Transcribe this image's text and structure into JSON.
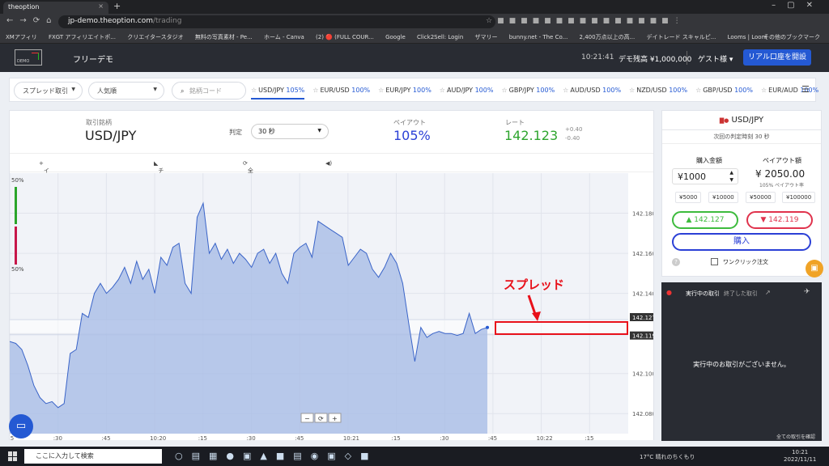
{
  "browser": {
    "tab_title": "theoption",
    "url_host": "jp-demo.theoption.com",
    "url_path": "/trading",
    "bookmarks": [
      "XMアフィリ",
      "FXGT アフィリエイトポ...",
      "クリエイタースタジオ",
      "無料の写真素材 - Pe...",
      "ホーム - Canva",
      "(2) 🔴 (FULL COUR...",
      "Google",
      "Click2Sell: Login",
      "ザマリー",
      "bunny.net - The Co...",
      "2,400万点以上の高...",
      "デイトレード スキャルピ...",
      "Looms | Loom"
    ],
    "bookmarks_other": "その他のブックマーク"
  },
  "header": {
    "logo_text": "DEMO",
    "mode_label": "フリーデモ",
    "time": "10:21:41",
    "balance": "デモ残高 ¥1,000,000",
    "user": "ゲスト様 ▾",
    "real_account_button": "リアル口座を開設"
  },
  "filters": {
    "type_select": "スプレッド取引",
    "sort_select": "人気順",
    "search_placeholder": "銘柄コード",
    "pairs": [
      {
        "name": "USD/JPY",
        "pct": "105%",
        "active": true
      },
      {
        "name": "EUR/USD",
        "pct": "100%",
        "active": false
      },
      {
        "name": "EUR/JPY",
        "pct": "100%",
        "active": false
      },
      {
        "name": "AUD/JPY",
        "pct": "100%",
        "active": false
      },
      {
        "name": "GBP/JPY",
        "pct": "100%",
        "active": false
      },
      {
        "name": "AUD/USD",
        "pct": "100%",
        "active": false
      },
      {
        "name": "NZD/USD",
        "pct": "100%",
        "active": false
      },
      {
        "name": "GBP/USD",
        "pct": "100%",
        "active": false
      },
      {
        "name": "EUR/AUD",
        "pct": "100%",
        "active": false
      }
    ]
  },
  "info": {
    "symbol_label": "取引銘柄",
    "symbol": "USD/JPY",
    "judge_label": "判定",
    "duration": "30 秒",
    "payout_label": "ペイアウト",
    "payout": "105%",
    "rate_label": "レート",
    "rate": "142.123",
    "rate_up": "+0.40",
    "rate_down": "-0.40"
  },
  "tools": {
    "add_indicator": "インジケーターを追加",
    "chart_type": "チャートの種類",
    "clear_all": "全てクリア"
  },
  "chart": {
    "pct_top": "50%",
    "pct_bottom": "50%",
    "annotation": "スプレッド",
    "ask_tag": "142.127",
    "bid_tag": "142.119",
    "zoom": [
      "−",
      "⟳",
      "+"
    ]
  },
  "chart_data": {
    "type": "area",
    "title": "",
    "xlabel": "",
    "ylabel": "",
    "ylim": [
      142.07,
      142.2
    ],
    "y_ticks": [
      142.08,
      142.1,
      142.12,
      142.14,
      142.16,
      142.18
    ],
    "x_tick_labels": [
      ":15",
      ":30",
      ":45",
      "10:20",
      ":15",
      ":30",
      ":45",
      "10:21",
      ":15",
      ":30",
      ":45",
      "10:22",
      ":15"
    ],
    "grid": true,
    "series": [
      {
        "values": [
          142.116,
          142.115,
          142.112,
          142.104,
          142.094,
          142.088,
          142.085,
          142.086,
          142.083,
          142.085,
          142.11,
          142.112,
          142.13,
          142.128,
          142.14,
          142.145,
          142.14,
          142.143,
          142.147,
          142.153,
          142.145,
          142.156,
          142.147,
          142.152,
          142.14,
          142.158,
          142.154,
          142.163,
          142.165,
          142.145,
          142.14,
          142.178,
          142.185,
          142.16,
          142.165,
          142.157,
          142.162,
          142.155,
          142.16,
          142.157,
          142.153,
          142.16,
          142.162,
          142.155,
          142.16,
          142.15,
          142.145,
          142.16,
          142.163,
          142.165,
          142.158,
          142.176,
          142.174,
          142.172,
          142.17,
          142.168,
          142.154,
          142.158,
          142.162,
          142.16,
          142.152,
          142.148,
          142.153,
          142.16,
          142.155,
          142.145,
          142.125,
          142.106,
          142.123,
          142.118,
          142.12,
          142.121,
          142.12,
          142.12,
          142.119,
          142.12,
          142.13,
          142.12,
          142.122,
          142.123
        ]
      }
    ]
  },
  "trade": {
    "symbol": "USD/JPY",
    "next_judge": "次回の判定時刻 30 秒",
    "amount_label": "購入金額",
    "amount": "¥1000",
    "payout_label": "ペイアウト額",
    "payout_amount": "¥ 2050.00",
    "payout_rate": "105% ペイアウト率",
    "quick_amounts": [
      "¥5000",
      "¥10000",
      "¥50000",
      "¥100000"
    ],
    "high_price": "142.127",
    "low_price": "142.119",
    "buy_button": "購入",
    "one_click": "ワンクリック注文"
  },
  "orders": {
    "tab_active": "実行中の取引",
    "tab_done": "終了した取引",
    "empty": "実行中のお取引がございません。",
    "confirm_all": "全ての取引を確認"
  },
  "taskbar": {
    "search_placeholder": "ここに入力して検索",
    "weather": "17°C 晴れのちくもり",
    "time": "10:21",
    "date": "2022/11/11"
  },
  "colors": {
    "accent": "#2459d3",
    "up": "#3dbb3d",
    "down": "#e0334d",
    "annotation": "#e8101a"
  }
}
